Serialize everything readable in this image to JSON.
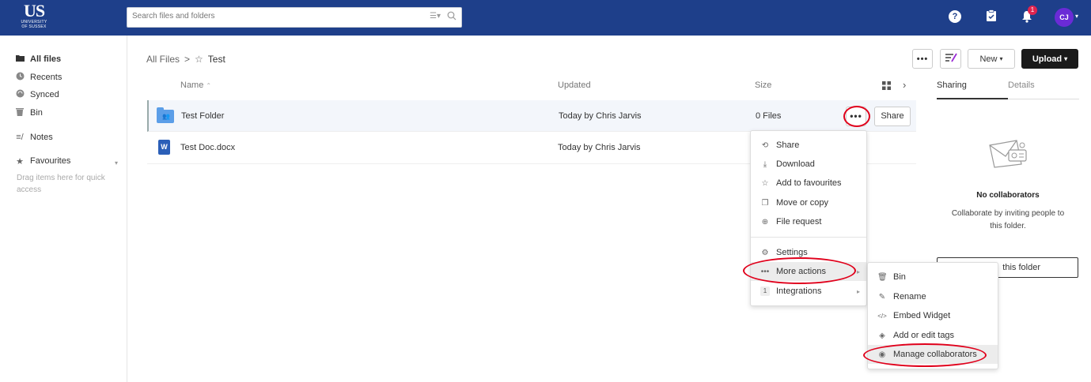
{
  "brand": {
    "logo_main": "US",
    "logo_sub1": "UNIVERSITY",
    "logo_sub2": "OF SUSSEX"
  },
  "search": {
    "placeholder": "Search files and folders"
  },
  "header": {
    "help_label": "?",
    "notification_count": "1",
    "user_initials": "CJ"
  },
  "sidebar": {
    "items": [
      {
        "label": "All files",
        "icon": "folder-icon"
      },
      {
        "label": "Recents",
        "icon": "clock-icon"
      },
      {
        "label": "Synced",
        "icon": "sync-icon"
      },
      {
        "label": "Bin",
        "icon": "bin-icon"
      },
      {
        "label": "Notes",
        "icon": "notes-icon"
      },
      {
        "label": "Favourites",
        "icon": "star-icon"
      }
    ],
    "drag_hint": "Drag items here for quick access"
  },
  "breadcrumb": {
    "root": "All Files",
    "separator": ">",
    "current": "Test"
  },
  "toolbar": {
    "more": "•••",
    "new_label": "New",
    "upload_label": "Upload"
  },
  "table": {
    "columns": {
      "name": "Name",
      "updated": "Updated",
      "size": "Size"
    },
    "rows": [
      {
        "name": "Test Folder",
        "updated": "Today by Chris Jarvis",
        "size": "0 Files",
        "type": "folder"
      },
      {
        "name": "Test Doc.docx",
        "updated": "Today by Chris Jarvis",
        "size": "",
        "type": "word-doc"
      }
    ],
    "row_more": "•••",
    "row_share": "Share"
  },
  "right_panel": {
    "tabs": [
      "Sharing",
      "Details"
    ],
    "no_collab_title": "No collaborators",
    "no_collab_text": "Collaborate by inviting people to this folder.",
    "invite_button": "this folder"
  },
  "context_menu": {
    "items": [
      {
        "label": "Share",
        "icon": "share-icon"
      },
      {
        "label": "Download",
        "icon": "download-icon"
      },
      {
        "label": "Add to favourites",
        "icon": "star-icon"
      },
      {
        "label": "Move or copy",
        "icon": "copy-icon"
      },
      {
        "label": "File request",
        "icon": "upload-cloud-icon"
      },
      {
        "label": "Settings",
        "icon": "gear-icon"
      },
      {
        "label": "More actions",
        "icon": "ellipsis-icon"
      },
      {
        "label": "Integrations",
        "icon": "integrations-icon",
        "badge": "1"
      }
    ]
  },
  "submenu": {
    "items": [
      {
        "label": "Bin",
        "icon": "bin-icon"
      },
      {
        "label": "Rename",
        "icon": "pencil-icon"
      },
      {
        "label": "Embed Widget",
        "icon": "code-icon"
      },
      {
        "label": "Add or edit tags",
        "icon": "tag-icon"
      },
      {
        "label": "Manage collaborators",
        "icon": "user-circle-icon"
      }
    ]
  },
  "colors": {
    "topbar": "#1e3f8a",
    "accent_ring": "#e0001b",
    "avatar": "#6a2bd6",
    "badge": "#e0244f"
  }
}
